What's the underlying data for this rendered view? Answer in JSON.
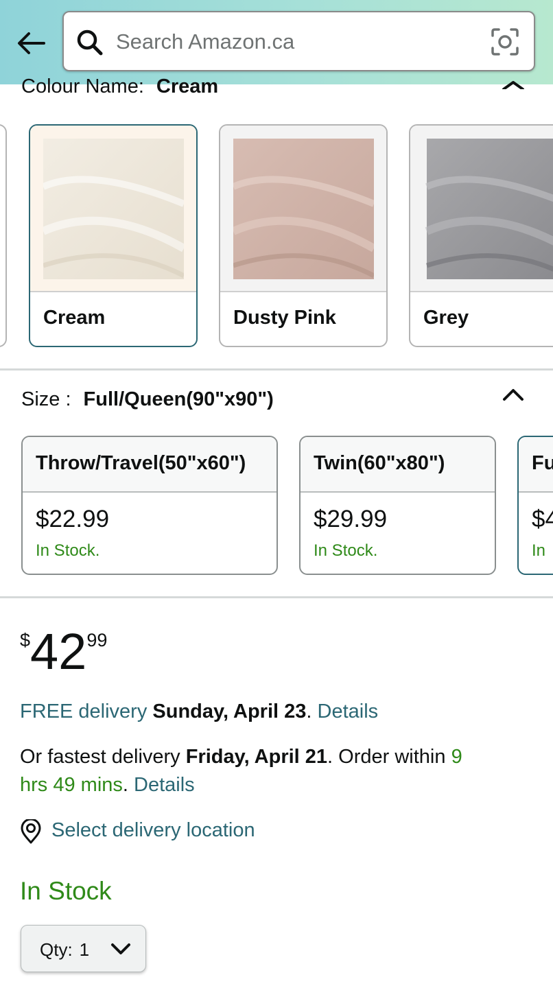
{
  "header": {
    "search_placeholder": "Search Amazon.ca",
    "icons": {
      "back": "back-arrow-icon",
      "search": "search-icon",
      "camera": "camera-scan-icon"
    }
  },
  "colour": {
    "label": "Colour Name:",
    "selected": "Cream",
    "swatches": [
      {
        "name": "Cream",
        "color": "#efe8dc",
        "selected": true
      },
      {
        "name": "Dusty Pink",
        "color": "#cfb2a8",
        "selected": false
      },
      {
        "name": "Grey",
        "color": "#9b9b9e",
        "selected": false
      }
    ]
  },
  "size": {
    "label": "Size :",
    "selected": "Full/Queen(90\"x90\")",
    "options": [
      {
        "name": "Throw/Travel(50\"x60\")",
        "price": "$22.99",
        "stock": "In Stock.",
        "selected": false
      },
      {
        "name": "Twin(60\"x80\")",
        "price": "$29.99",
        "stock": "In Stock.",
        "selected": false
      },
      {
        "name": "Fu",
        "price": "$4",
        "stock": "In",
        "selected": true
      }
    ]
  },
  "price": {
    "symbol": "$",
    "whole": "42",
    "fraction": "99"
  },
  "delivery": {
    "free_label": "FREE delivery",
    "free_date": "Sunday, April 23",
    "period": ".",
    "details": "Details",
    "fast_prefix": "Or fastest delivery",
    "fast_date": "Friday, April 21",
    "order_within": ". Order within",
    "countdown_part1": "9",
    "countdown_part2": "hrs 49 mins",
    "location_link": "Select delivery location"
  },
  "stock_status": "In Stock",
  "quantity": {
    "label": "Qty:",
    "value": "1"
  },
  "colors": {
    "link": "#2b6774",
    "in_stock": "#2f8a19",
    "selected_border": "#2b6774"
  }
}
